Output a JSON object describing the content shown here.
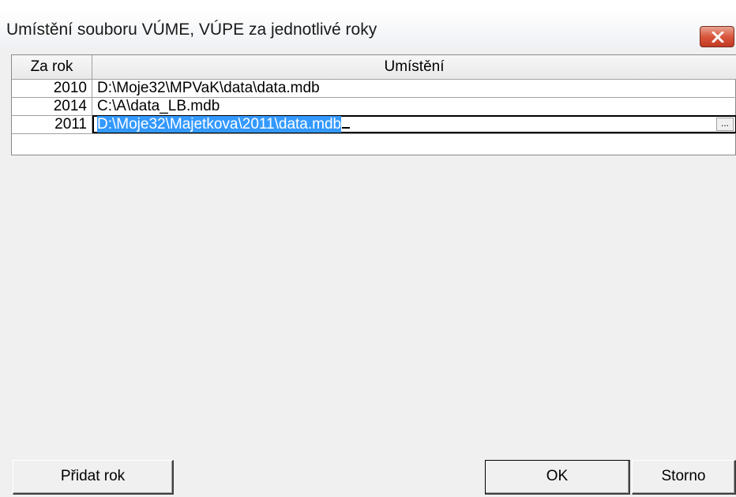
{
  "window": {
    "title": "Umístění souboru VÚME, VÚPE za jednotlivé roky"
  },
  "table": {
    "columns": [
      "Za rok",
      "Umístění"
    ],
    "rows": [
      {
        "year": "2010",
        "path": "D:\\Moje32\\MPVaK\\data\\data.mdb"
      },
      {
        "year": "2014",
        "path": "C:\\A\\data_LB.mdb"
      },
      {
        "year": "2011",
        "path": "D:\\Moje32\\Majetkova\\2011\\data.mdb"
      }
    ],
    "browse_label": "..."
  },
  "buttons": {
    "add_year": "Přidat rok",
    "ok": "OK",
    "cancel": "Storno"
  },
  "colors": {
    "selection": "#3399ff",
    "close_button": "#d9573c"
  }
}
